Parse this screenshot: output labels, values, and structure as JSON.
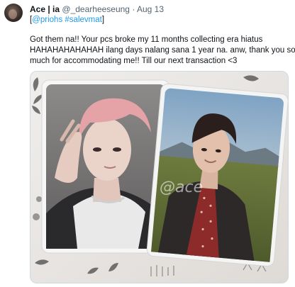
{
  "tweet": {
    "display_name": "Ace | ia",
    "handle": "@_dearheeseung",
    "separator": "·",
    "date": "Aug 13",
    "tags_open": "[",
    "mention": "@priohs",
    "hashtag": "#salevmat",
    "tags_close": "]",
    "body_lines": [
      "Got them na!! Your pcs broke my 11 months collecting era hiatus",
      "HAHAHAHAHAHAH ilang days nalang sana 1 year na. anw, thank you so",
      "much for accommodating me!! Till our next transaction <3"
    ],
    "photo": {
      "watermark": "@ace"
    }
  }
}
